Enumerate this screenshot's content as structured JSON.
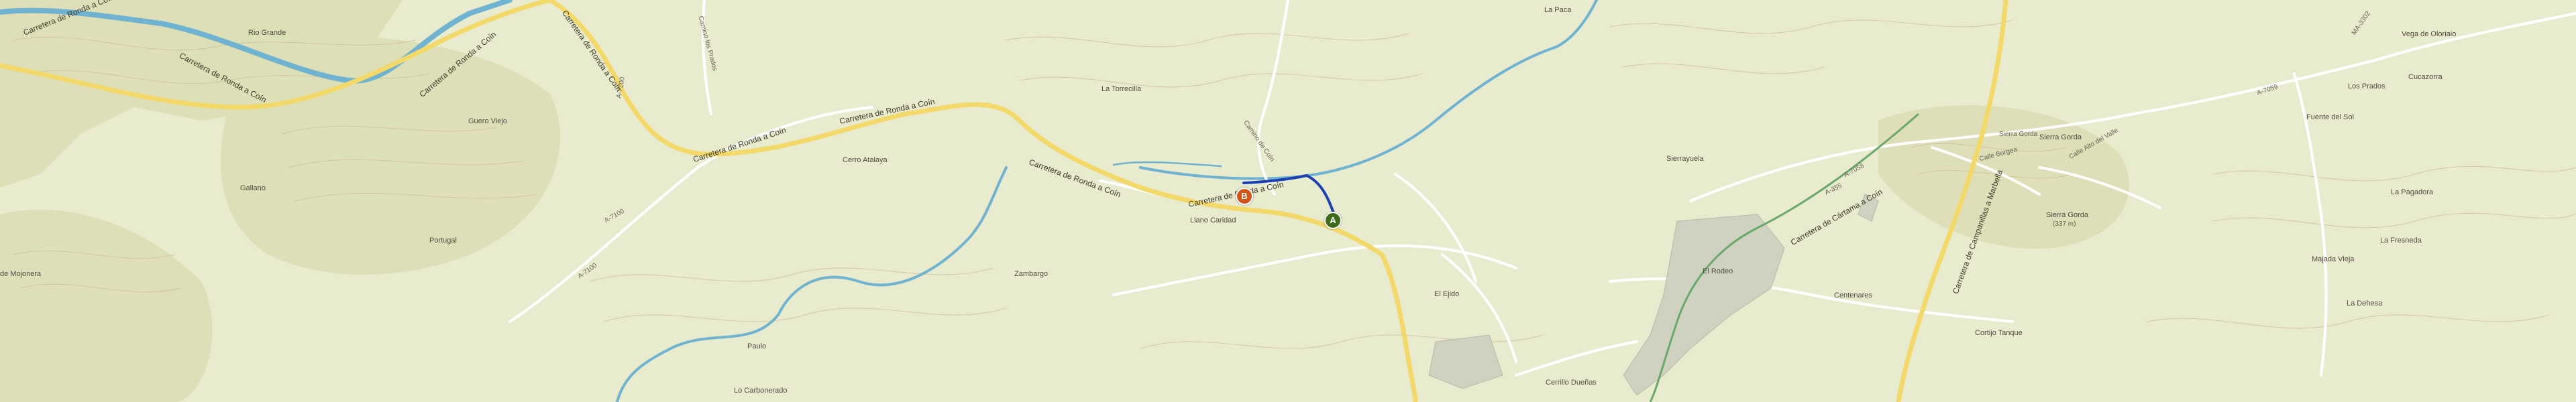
{
  "places": {
    "rio_grande": "Rio Grande",
    "la_paca": "La Paca",
    "vega_de_oloriaio": "Vega de Oloriaio",
    "cucazorra": "Cucazorra",
    "los_prados": "Los Prados",
    "fuente_del_sol": "Fuente del Sol",
    "la_torrecilla": "La Torrecilla",
    "guero_viejo": "Guero Viejo",
    "cerro_atalaya": "Cerro Atalaya",
    "gallano": "Gallano",
    "portugal": "Portugal",
    "de_mojonera": "de Mojonera",
    "llano_caridad": "Llano Caridad",
    "zambargo": "Zambargo",
    "paulo": "Paulo",
    "lo_carbonerado": "Lo Carbonerado",
    "sierrayuela": "Sierrayuela",
    "el_ejido": "El Ejido",
    "el_rodeo": "El Rodeo",
    "centenares": "Centenares",
    "cortijo_tanque": "Cortijo Tanque",
    "cerrillo_duenas": "Cerrillo Dueñas",
    "sierra_gorda": "Sierra Gorda",
    "la_pagadora": "La Pagadora",
    "la_fresneda": "La Fresneda",
    "majada_vieja": "Majada Vieja",
    "la_dehesa": "La Dehesa",
    "sierra_gorda_peak": "Sierra Gorda",
    "sierra_gorda_elev": "(337 m)"
  },
  "roads": {
    "ronda_coin_1": "Carretera de Ronda a Coín",
    "ronda_coin_2": "Carretera de Ronda a Coín",
    "ronda_coin_3": "Carretera de Ronda a Coín",
    "ronda_coin_4": "Carretera de Ronda a Coín",
    "ronda_coin_5": "Carretera de Ronda a Coín",
    "ronda_coin_6": "Carretera de Ronda a Coín",
    "cartama_coin": "Carretera de Cártama a Coín",
    "campanillas_marbella": "Carretera de Campanillas a Marbella",
    "a7100_1": "A-7100",
    "a7100_2": "A-7100",
    "a7100_3": "A-7100",
    "a7059": "A-7059",
    "a7058": "A-7058",
    "a355": "A-355",
    "ma3302": "MA-3302",
    "calle_borgea": "Calle Borgea",
    "calle_alto_valle": "Calle Alto del Valle",
    "camino_coin": "Camino de Coín",
    "sierra_gorda_rd": "Sierra Gorda",
    "camino_prados": "Camino los Prados"
  },
  "markers": {
    "a": {
      "letter": "A",
      "color": "#3d6a1b"
    },
    "b": {
      "letter": "B",
      "color": "#d1561a"
    }
  },
  "colors": {
    "land": "#e9ebcf",
    "hills": "#d9dbb0",
    "river": "#6fb3d0",
    "road_major": "#f3d86a",
    "road_minor": "#ffffff",
    "route": "#1b3fb0",
    "urban": "#cfd2c0"
  }
}
